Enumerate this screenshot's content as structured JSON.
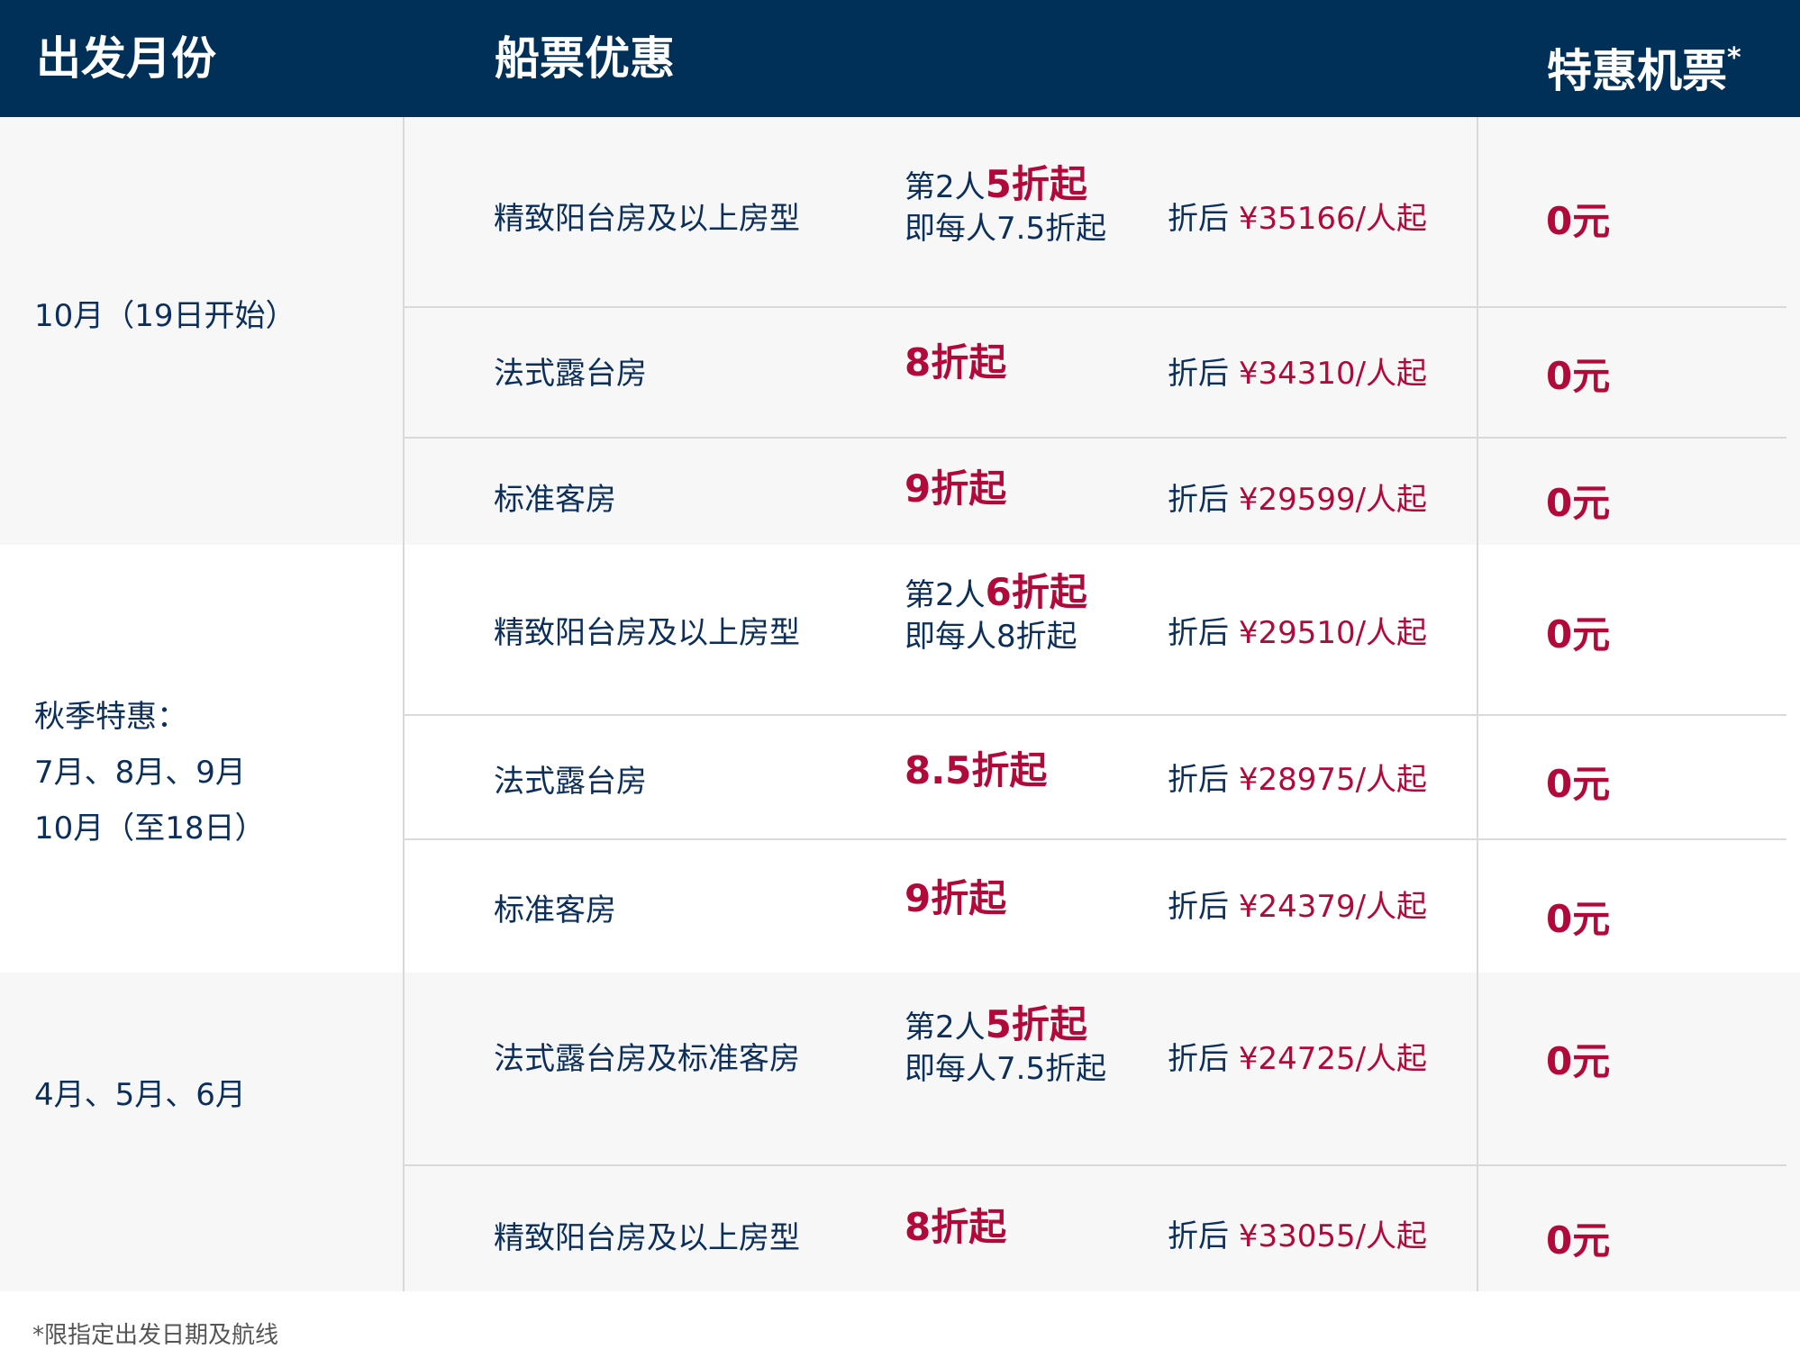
{
  "header": {
    "col_month": "出发月份",
    "col_cruise": "船票优惠",
    "col_flight": "特惠机票",
    "flight_star": "*"
  },
  "groups": [
    {
      "month_lines": [
        "10月（19日开始）"
      ],
      "rows": [
        {
          "room": "精致阳台房及以上房型",
          "disc_pre": "第2人",
          "disc_big": "5折起",
          "disc_line2": "即每人7.5折起",
          "price_pre": "折后 ",
          "price": "¥35166/人起",
          "air": "0元"
        },
        {
          "room": "法式露台房",
          "disc_only": "8折起",
          "price_pre": "折后 ",
          "price": "¥34310/人起",
          "air": "0元"
        },
        {
          "room": "标准客房",
          "disc_only": "9折起",
          "price_pre": "折后 ",
          "price": "¥29599/人起",
          "air": "0元"
        }
      ]
    },
    {
      "month_lines": [
        "秋季特惠：",
        "7月、8月、9月",
        "10月（至18日）"
      ],
      "rows": [
        {
          "room": "精致阳台房及以上房型",
          "disc_pre": "第2人",
          "disc_big": "6折起",
          "disc_line2": "即每人8折起",
          "price_pre": "折后 ",
          "price": "¥29510/人起",
          "air": "0元"
        },
        {
          "room": "法式露台房",
          "disc_only": "8.5折起",
          "price_pre": "折后 ",
          "price": "¥28975/人起",
          "air": "0元"
        },
        {
          "room": "标准客房",
          "disc_only": "9折起",
          "price_pre": "折后 ",
          "price": "¥24379/人起",
          "air": "0元"
        }
      ]
    },
    {
      "month_lines": [
        "4月、5月、6月"
      ],
      "rows": [
        {
          "room": "法式露台房及标准客房",
          "disc_pre": "第2人",
          "disc_big": "5折起",
          "disc_line2": "即每人7.5折起",
          "price_pre": "折后 ",
          "price": "¥24725/人起",
          "air": "0元"
        },
        {
          "room": "精致阳台房及以上房型",
          "disc_only": "8折起",
          "price_pre": "折后 ",
          "price": "¥33055/人起",
          "air": "0元"
        }
      ]
    }
  ],
  "footnote": "*限指定出发日期及航线",
  "colors": {
    "header_bg": "#003057",
    "accent_red": "#b0093a",
    "text_navy": "#0b2e5a",
    "row_gray": "#f7f7f7"
  }
}
